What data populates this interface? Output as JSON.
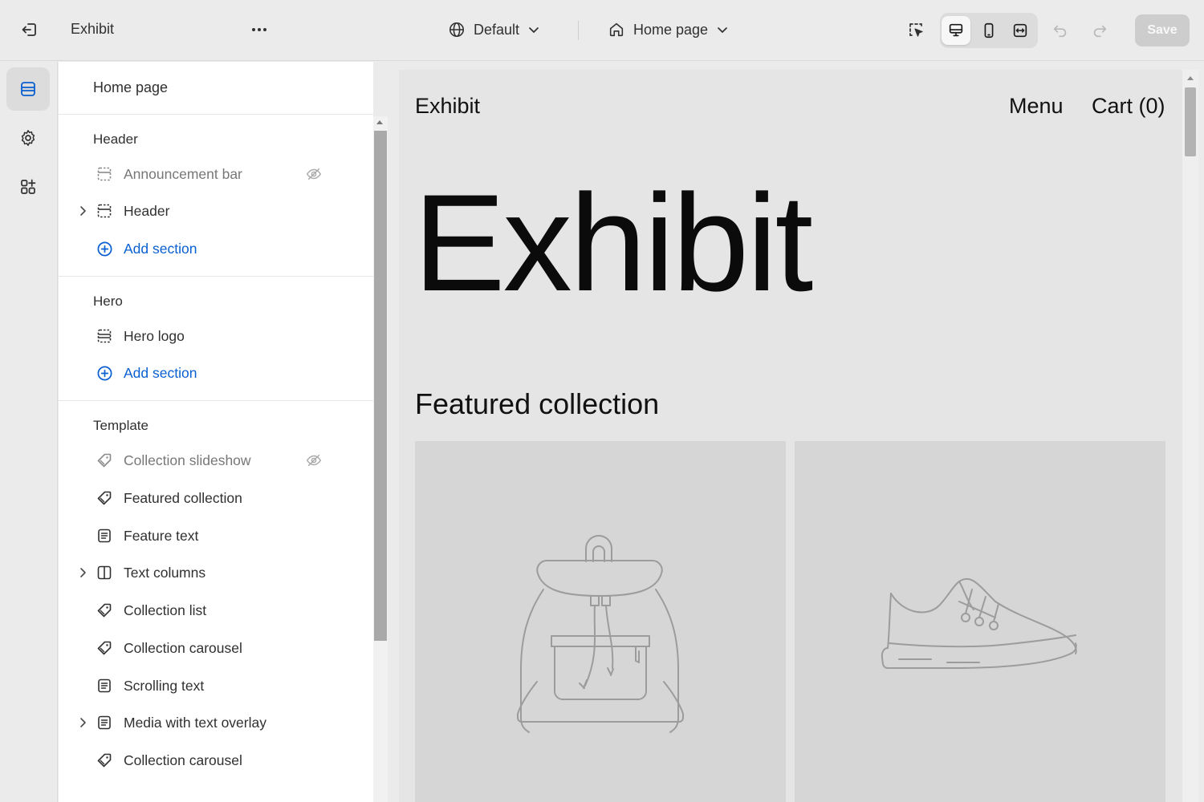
{
  "topbar": {
    "app_name": "Exhibit",
    "theme_dropdown": "Default",
    "page_dropdown": "Home page",
    "save_label": "Save"
  },
  "sidebar": {
    "title": "Home page",
    "groups": [
      {
        "label": "Header",
        "items": [
          {
            "label": "Announcement bar",
            "hidden": true
          },
          {
            "label": "Header",
            "expandable": true
          }
        ],
        "add_label": "Add section"
      },
      {
        "label": "Hero",
        "items": [
          {
            "label": "Hero logo"
          }
        ],
        "add_label": "Add section"
      },
      {
        "label": "Template",
        "items": [
          {
            "label": "Collection slideshow",
            "hidden": true
          },
          {
            "label": "Featured collection"
          },
          {
            "label": "Feature text"
          },
          {
            "label": "Text columns",
            "expandable": true
          },
          {
            "label": "Collection list"
          },
          {
            "label": "Collection carousel"
          },
          {
            "label": "Scrolling text"
          },
          {
            "label": "Media with text overlay",
            "expandable": true
          },
          {
            "label": "Collection carousel"
          }
        ]
      }
    ]
  },
  "preview": {
    "brand": "Exhibit",
    "menu": "Menu",
    "cart": "Cart (0)",
    "hero_text": "Exhibit",
    "featured_heading": "Featured collection"
  },
  "colors": {
    "accent": "#0a5fd1",
    "preview_bg": "#e5e5e5",
    "card_bg": "#d6d6d6"
  }
}
